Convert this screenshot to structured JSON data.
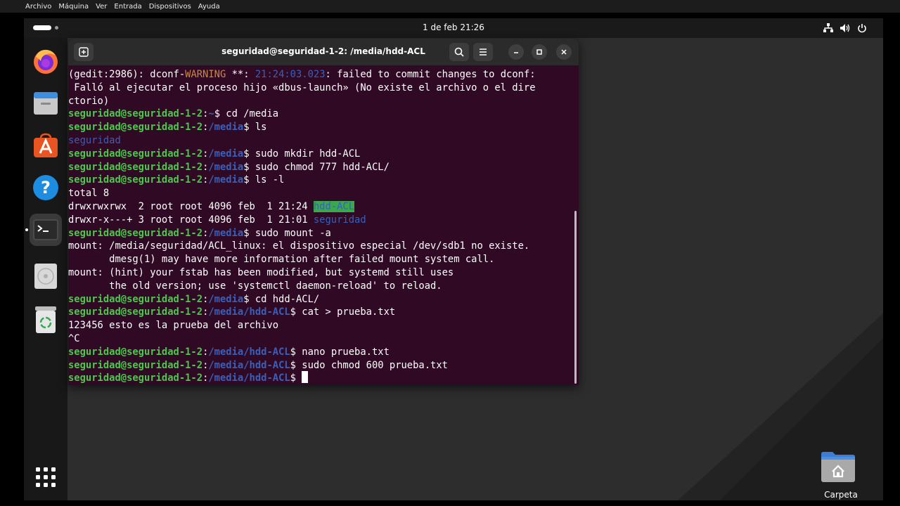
{
  "vbox_menu": [
    "Archivo",
    "Máquina",
    "Ver",
    "Entrada",
    "Dispositivos",
    "Ayuda"
  ],
  "topbar": {
    "clock": "1 de feb  21:26"
  },
  "dock": {
    "items": [
      "firefox-icon",
      "files-icon",
      "app-center-icon",
      "help-icon",
      "terminal-icon",
      "disc-icon",
      "trash-icon",
      "show-apps-icon"
    ]
  },
  "terminal": {
    "title": "seguridad@seguridad-1-2: /media/hdd-ACL",
    "prompt_user": "seguridad@seguridad-1-2",
    "lines": {
      "l1_a": "(gedit:2986): dconf-",
      "l1_warn": "WARNING",
      "l1_b": " **: ",
      "l1_ts": "21:24:03.023",
      "l1_c": ": failed to commit changes to dconf:",
      "l2": " Falló al ejecutar el proceso hijo «dbus-launch» (No existe el archivo o el dire",
      "l3": "ctorio)",
      "c1_path": "~",
      "c1_cmd": "$ cd /media",
      "c2_path": "/media",
      "c2_cmd": "$ ls",
      "o_seguridad": "seguridad",
      "c3_path": "/media",
      "c3_cmd": "$ sudo mkdir hdd-ACL",
      "c4_path": "/media",
      "c4_cmd": "$ sudo chmod 777 hdd-ACL/",
      "c5_path": "/media",
      "c5_cmd": "$ ls -l",
      "o_total": "total 8",
      "o_ls1_a": "drwxrwxrwx  2 root root 4096 feb  1 21:24 ",
      "o_ls1_name": "hdd-ACL",
      "o_ls2_a": "drwxr-x---+ 3 root root 4096 feb  1 21:01 ",
      "o_ls2_name": "seguridad",
      "c6_path": "/media",
      "c6_cmd": "$ sudo mount -a",
      "o_m1": "mount: /media/seguridad/ACL_linux: el dispositivo especial /dev/sdb1 no existe.",
      "o_m2": "       dmesg(1) may have more information after failed mount system call.",
      "o_m3": "mount: (hint) your fstab has been modified, but systemd still uses",
      "o_m4": "       the old version; use 'systemctl daemon-reload' to reload.",
      "c7_path": "/media",
      "c7_cmd": "$ cd hdd-ACL/",
      "c8_path": "/media/hdd-ACL",
      "c8_cmd": "$ cat > prueba.txt",
      "o_cat": "123456 esto es la prueba del archivo",
      "o_ctrlc": "^C",
      "c9_path": "/media/hdd-ACL",
      "c9_cmd": "$ nano prueba.txt",
      "c10_path": "/media/hdd-ACL",
      "c10_cmd": "$ sudo chmod 600 prueba.txt",
      "c11_path": "/media/hdd-ACL",
      "c11_cmd": "$ "
    }
  },
  "desktop": {
    "home_folder_label": "Carpeta personal"
  },
  "colors": {
    "terminal_bg": "#300a24",
    "prompt_user": "#4bc94b",
    "prompt_path": "#3a5fb8",
    "warning": "#c9874a",
    "highlight_bg": "#3aa84f"
  }
}
